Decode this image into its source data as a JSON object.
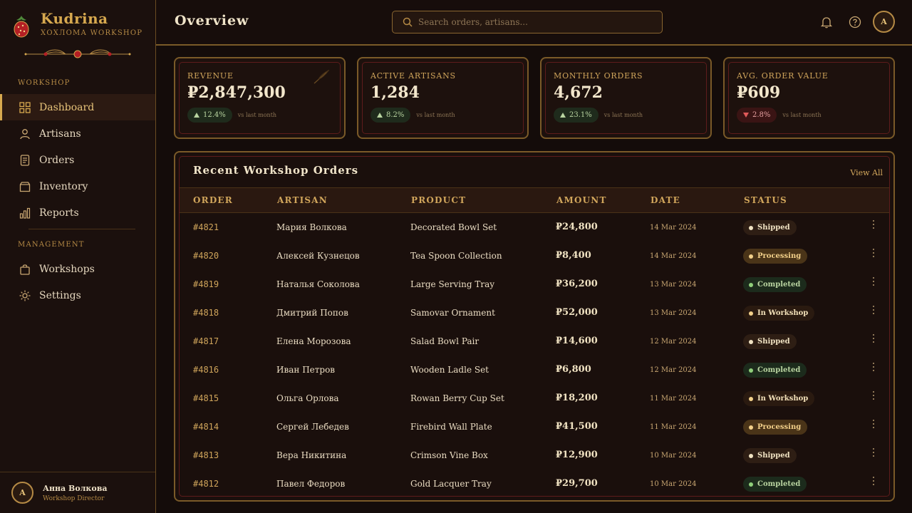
{
  "brand": {
    "name": "Kudrina",
    "subtitle": "ХОХЛОМА WORKSHOP"
  },
  "sidebar": {
    "section_workshop": "WORKSHOP",
    "section_management": "MANAGEMENT",
    "items": [
      {
        "label": "Dashboard",
        "icon": "grid-icon",
        "active": true
      },
      {
        "label": "Artisans",
        "icon": "user-icon"
      },
      {
        "label": "Orders",
        "icon": "document-icon"
      },
      {
        "label": "Inventory",
        "icon": "box-icon"
      },
      {
        "label": "Reports",
        "icon": "bar-chart-icon"
      }
    ],
    "management_items": [
      {
        "label": "Workshops",
        "icon": "bag-icon"
      },
      {
        "label": "Settings",
        "icon": "sun-gear-icon"
      }
    ],
    "user": {
      "initial": "A",
      "name": "Анна Волкова",
      "role": "Workshop Director"
    }
  },
  "header": {
    "title": "Overview",
    "search_placeholder": "Search orders, artisans...",
    "avatar_initial": "A"
  },
  "stats": [
    {
      "label": "REVENUE",
      "value": "₽2,847,300",
      "change": "12.4%",
      "direction": "up",
      "note": "vs last month"
    },
    {
      "label": "ACTIVE ARTISANS",
      "value": "1,284",
      "change": "8.2%",
      "direction": "up",
      "note": "vs last month"
    },
    {
      "label": "MONTHLY ORDERS",
      "value": "4,672",
      "change": "23.1%",
      "direction": "up",
      "note": "vs last month"
    },
    {
      "label": "AVG. ORDER VALUE",
      "value": "₽609",
      "change": "2.8%",
      "direction": "down",
      "note": "vs last month"
    }
  ],
  "orders": {
    "title": "Recent Workshop Orders",
    "view_all": "View All",
    "columns": [
      "ORDER",
      "ARTISAN",
      "PRODUCT",
      "AMOUNT",
      "DATE",
      "STATUS"
    ],
    "rows": [
      {
        "order": "#4821",
        "artisan": "Мария Волкова",
        "product": "Decorated Bowl Set",
        "amount": "₽24,800",
        "date": "14 Mar 2024",
        "status": "Shipped"
      },
      {
        "order": "#4820",
        "artisan": "Алексей Кузнецов",
        "product": "Tea Spoon Collection",
        "amount": "₽8,400",
        "date": "14 Mar 2024",
        "status": "Processing"
      },
      {
        "order": "#4819",
        "artisan": "Наталья Соколова",
        "product": "Large Serving Tray",
        "amount": "₽36,200",
        "date": "13 Mar 2024",
        "status": "Completed"
      },
      {
        "order": "#4818",
        "artisan": "Дмитрий Попов",
        "product": "Samovar Ornament",
        "amount": "₽52,000",
        "date": "13 Mar 2024",
        "status": "In Workshop"
      },
      {
        "order": "#4817",
        "artisan": "Елена Морозова",
        "product": "Salad Bowl Pair",
        "amount": "₽14,600",
        "date": "12 Mar 2024",
        "status": "Shipped"
      },
      {
        "order": "#4816",
        "artisan": "Иван Петров",
        "product": "Wooden Ladle Set",
        "amount": "₽6,800",
        "date": "12 Mar 2024",
        "status": "Completed"
      },
      {
        "order": "#4815",
        "artisan": "Ольга Орлова",
        "product": "Rowan Berry Cup Set",
        "amount": "₽18,200",
        "date": "11 Mar 2024",
        "status": "In Workshop"
      },
      {
        "order": "#4814",
        "artisan": "Сергей Лебедев",
        "product": "Firebird Wall Plate",
        "amount": "₽41,500",
        "date": "11 Mar 2024",
        "status": "Processing"
      },
      {
        "order": "#4813",
        "artisan": "Вера Никитина",
        "product": "Crimson Vine Box",
        "amount": "₽12,900",
        "date": "10 Mar 2024",
        "status": "Shipped"
      },
      {
        "order": "#4812",
        "artisan": "Павел Федоров",
        "product": "Gold Lacquer Tray",
        "amount": "₽29,700",
        "date": "10 Mar 2024",
        "status": "Completed"
      }
    ]
  },
  "colors": {
    "accent": "#d7a94f",
    "border": "#7a5a28",
    "crimson": "#5e1c1c",
    "background": "#140c0a"
  }
}
